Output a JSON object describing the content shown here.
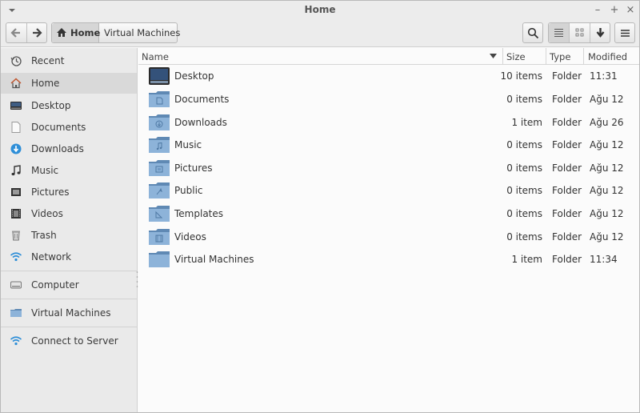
{
  "window": {
    "title": "Home"
  },
  "toolbar": {
    "breadcrumbs": [
      "Home",
      "Virtual Machines"
    ]
  },
  "sidebar": {
    "places": [
      {
        "label": "Recent",
        "icon": "recent-icon"
      },
      {
        "label": "Home",
        "icon": "home-icon",
        "active": true
      },
      {
        "label": "Desktop",
        "icon": "desktop-icon"
      },
      {
        "label": "Documents",
        "icon": "documents-icon"
      },
      {
        "label": "Downloads",
        "icon": "downloads-icon"
      },
      {
        "label": "Music",
        "icon": "music-icon"
      },
      {
        "label": "Pictures",
        "icon": "pictures-icon"
      },
      {
        "label": "Videos",
        "icon": "videos-icon"
      },
      {
        "label": "Trash",
        "icon": "trash-icon"
      },
      {
        "label": "Network",
        "icon": "network-icon"
      }
    ],
    "devices": [
      {
        "label": "Computer",
        "icon": "computer-icon"
      }
    ],
    "bookmarks": [
      {
        "label": "Virtual Machines",
        "icon": "folder-icon"
      }
    ],
    "network": [
      {
        "label": "Connect to Server",
        "icon": "network-icon"
      }
    ]
  },
  "list": {
    "columns": {
      "name": "Name",
      "size": "Size",
      "type": "Type",
      "modified": "Modified"
    },
    "rows": [
      {
        "name": "Desktop",
        "size": "10 items",
        "type": "Folder",
        "modified": "11:31",
        "icon": "desktop-folder-icon"
      },
      {
        "name": "Documents",
        "size": "0 items",
        "type": "Folder",
        "modified": "Ağu 12",
        "icon": "documents-folder-icon"
      },
      {
        "name": "Downloads",
        "size": "1 item",
        "type": "Folder",
        "modified": "Ağu 26",
        "icon": "downloads-folder-icon"
      },
      {
        "name": "Music",
        "size": "0 items",
        "type": "Folder",
        "modified": "Ağu 12",
        "icon": "music-folder-icon"
      },
      {
        "name": "Pictures",
        "size": "0 items",
        "type": "Folder",
        "modified": "Ağu 12",
        "icon": "pictures-folder-icon"
      },
      {
        "name": "Public",
        "size": "0 items",
        "type": "Folder",
        "modified": "Ağu 12",
        "icon": "public-folder-icon"
      },
      {
        "name": "Templates",
        "size": "0 items",
        "type": "Folder",
        "modified": "Ağu 12",
        "icon": "templates-folder-icon"
      },
      {
        "name": "Videos",
        "size": "0 items",
        "type": "Folder",
        "modified": "Ağu 12",
        "icon": "videos-folder-icon"
      },
      {
        "name": "Virtual Machines",
        "size": "1 item",
        "type": "Folder",
        "modified": "11:34",
        "icon": "folder-icon"
      }
    ]
  },
  "colors": {
    "folder": "#7fa7cf",
    "folder_dark": "#5f89b4",
    "sidebar_bg": "#eaeaea",
    "selected": "#d9d9d9",
    "accent_blue": "#2f8fd8"
  }
}
